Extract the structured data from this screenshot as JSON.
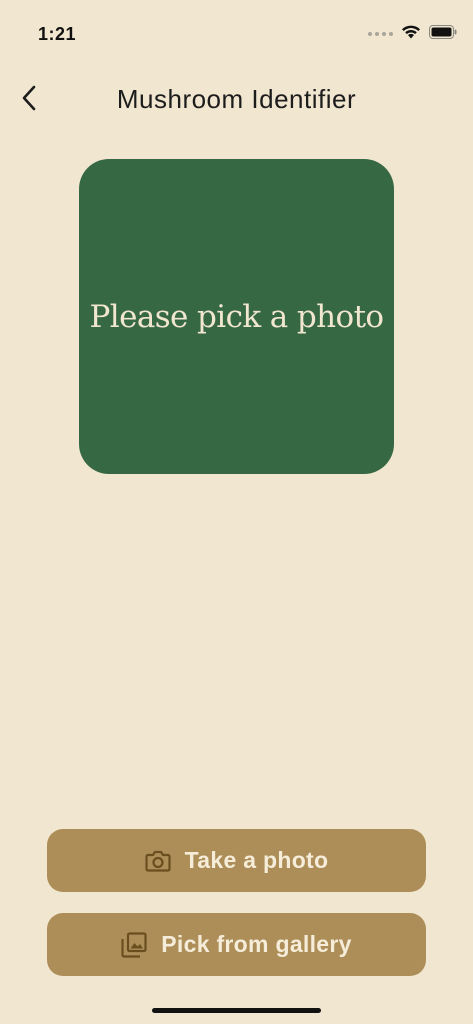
{
  "status_bar": {
    "time": "1:21"
  },
  "nav": {
    "title": "Mushroom Identifier",
    "back_icon": "chevron-left-icon"
  },
  "photo_box": {
    "placeholder": "Please pick a photo",
    "color": "#376844"
  },
  "actions": {
    "take_photo_label": "Take a photo",
    "take_photo_icon": "camera-icon",
    "gallery_label": "Pick from gallery",
    "gallery_icon": "photo-library-icon"
  },
  "colors": {
    "background": "#F1E6CF",
    "button": "#AD8E58",
    "button_text": "#F5ECD9",
    "icon": "#6B4E1F"
  }
}
